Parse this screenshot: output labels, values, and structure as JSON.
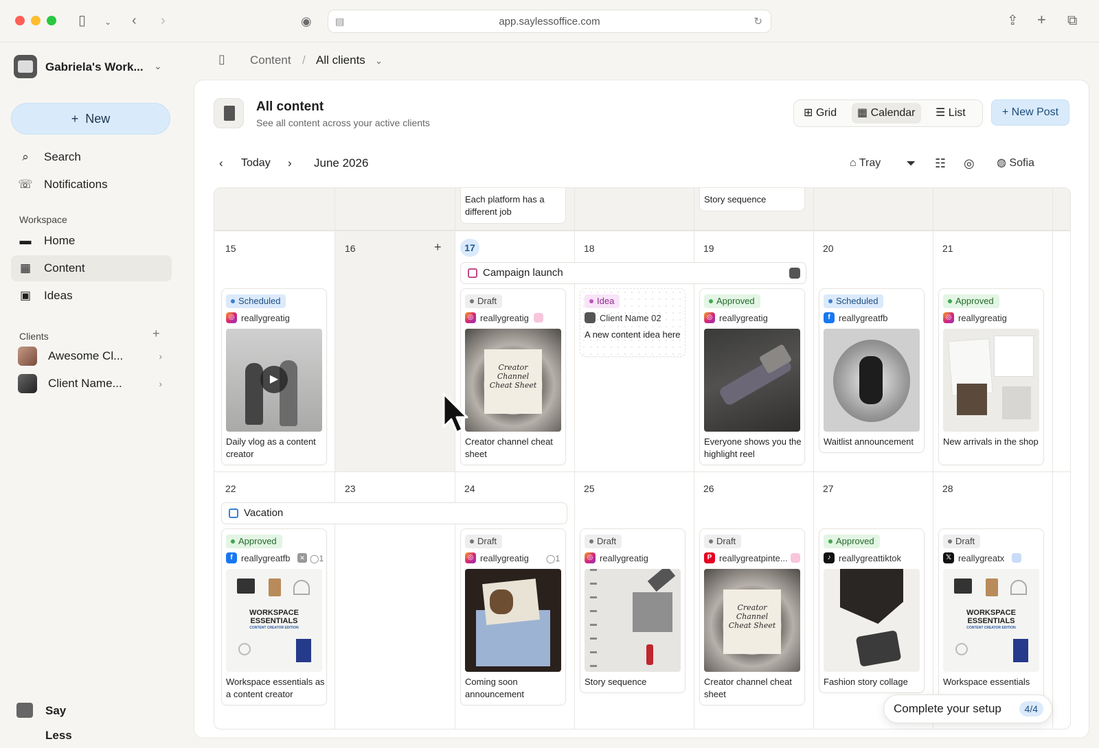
{
  "browser": {
    "url": "app.saylessoffice.com"
  },
  "sidebar": {
    "workspace_name": "Gabriela's Work...",
    "new_label": "New",
    "nav": [
      {
        "label": "Search",
        "icon": "search-icon"
      },
      {
        "label": "Notifications",
        "icon": "phone-icon"
      }
    ],
    "workspace_section": "Workspace",
    "workspace_items": [
      {
        "label": "Home",
        "icon": "monitor-icon"
      },
      {
        "label": "Content",
        "icon": "cabinet-icon",
        "active": true
      },
      {
        "label": "Ideas",
        "icon": "floppy-icon"
      }
    ],
    "clients_section": "Clients",
    "clients": [
      {
        "label": "Awesome Cl..."
      },
      {
        "label": "Client Name..."
      }
    ],
    "brand": "Say Less Office."
  },
  "breadcrumb": {
    "root": "Content",
    "separator": "/",
    "current": "All clients"
  },
  "header": {
    "title": "All content",
    "subtitle": "See all content across your active clients"
  },
  "views": {
    "grid": "Grid",
    "calendar": "Calendar",
    "list": "List",
    "active": "calendar"
  },
  "new_post": "+ New Post",
  "calendar": {
    "today_label": "Today",
    "month": "June 2026",
    "tools": {
      "tray": "Tray",
      "user": "Sofia"
    },
    "prev_row": [
      "Each platform has a different job",
      "Story sequence"
    ],
    "week1": {
      "days": [
        "15",
        "16",
        "17",
        "18",
        "19",
        "20",
        "21"
      ],
      "today": "17",
      "event": "Campaign launch"
    },
    "week2": {
      "days": [
        "22",
        "23",
        "24",
        "25",
        "26",
        "27",
        "28"
      ],
      "event": "Vacation"
    },
    "cards": [
      {
        "status": "Scheduled",
        "account": "reallygreatig",
        "platform": "ig",
        "title": "Daily vlog as a content creator"
      },
      {
        "status": "Draft",
        "account": "reallygreatig",
        "platform": "ig",
        "title": "Creator channel cheat sheet"
      },
      {
        "status": "Idea",
        "account": "Client Name 02",
        "platform": "client",
        "title": "A new content idea here"
      },
      {
        "status": "Approved",
        "account": "reallygreatig",
        "platform": "ig",
        "title": "Everyone shows you the highlight reel"
      },
      {
        "status": "Scheduled",
        "account": "reallygreatfb",
        "platform": "fb",
        "title": "Waitlist announcement"
      },
      {
        "status": "Approved",
        "account": "reallygreatig",
        "platform": "ig",
        "title": "New arrivals in the shop"
      },
      {
        "status": "Approved",
        "account": "reallygreatfb",
        "platform": "fb",
        "title": "Workspace essentials as a content creator",
        "comments": "1"
      },
      {
        "status": "Draft",
        "account": "reallygreatig",
        "platform": "ig",
        "title": "Coming soon announcement",
        "comments": "1"
      },
      {
        "status": "Draft",
        "account": "reallygreatig",
        "platform": "ig",
        "title": "Story sequence"
      },
      {
        "status": "Draft",
        "account": "reallygreatpinte...",
        "platform": "pin",
        "title": "Creator channel cheat sheet"
      },
      {
        "status": "Approved",
        "account": "reallygreattiktok",
        "platform": "tt",
        "title": "Fashion story collage"
      },
      {
        "status": "Draft",
        "account": "reallygreatx",
        "platform": "x",
        "title": "Workspace essentials"
      }
    ],
    "thumb_texts": {
      "cheat_line1": "Creator Channel",
      "cheat_line2": "Cheat Sheet",
      "ws_line1": "WORKSPACE",
      "ws_line2": "ESSENTIALS",
      "ws_line3": "CONTENT CREATOR EDITION"
    }
  },
  "setup": {
    "label": "Complete your setup",
    "count": "4/4"
  },
  "colors": {
    "accent": "#d9ebfb",
    "accent_text": "#1e4d7a"
  }
}
